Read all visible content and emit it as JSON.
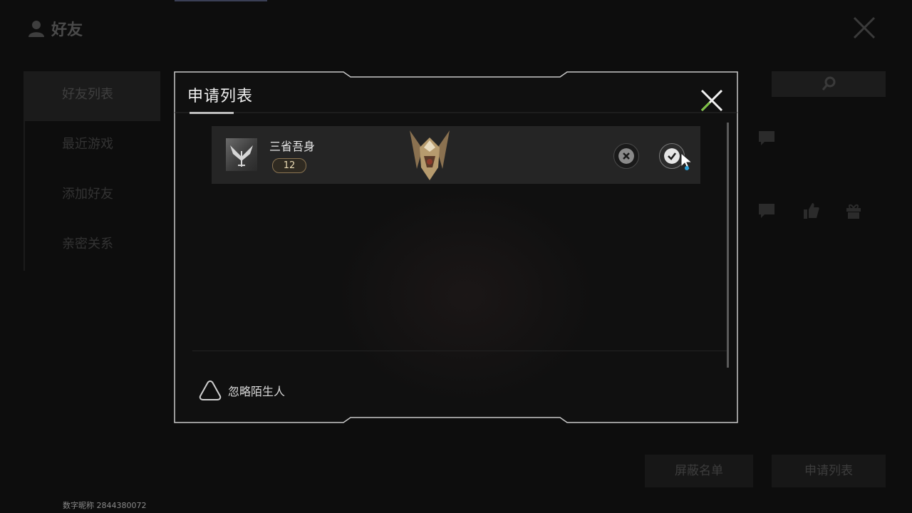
{
  "background": {
    "title": "好友",
    "nav_items": [
      {
        "label": "好友列表",
        "active": true
      },
      {
        "label": "最近游戏",
        "active": false
      },
      {
        "label": "添加好友",
        "active": false
      },
      {
        "label": "亲密关系",
        "active": false
      }
    ],
    "buttons": {
      "blocklist": "屏蔽名单",
      "requests": "申请列表"
    },
    "digital_id": "数字昵称 2844380072"
  },
  "dialog": {
    "title": "申请列表",
    "requests": [
      {
        "name": "三省吾身",
        "level": "12"
      }
    ],
    "ignore_strangers_label": "忽略陌生人"
  },
  "colors": {
    "accent_green": "#7cc242",
    "level_badge_border": "#8a7451",
    "level_badge_text": "#e9d9b2",
    "frame": "#c8c8c8"
  },
  "icons": {
    "close": "close-x-icon",
    "reject": "circle-x-icon",
    "accept": "circle-check-icon",
    "ignore": "triangle-toggle-icon",
    "search": "search-icon",
    "chat": "chat-bubble-icon",
    "like": "thumbs-up-icon",
    "gift": "gift-icon"
  }
}
